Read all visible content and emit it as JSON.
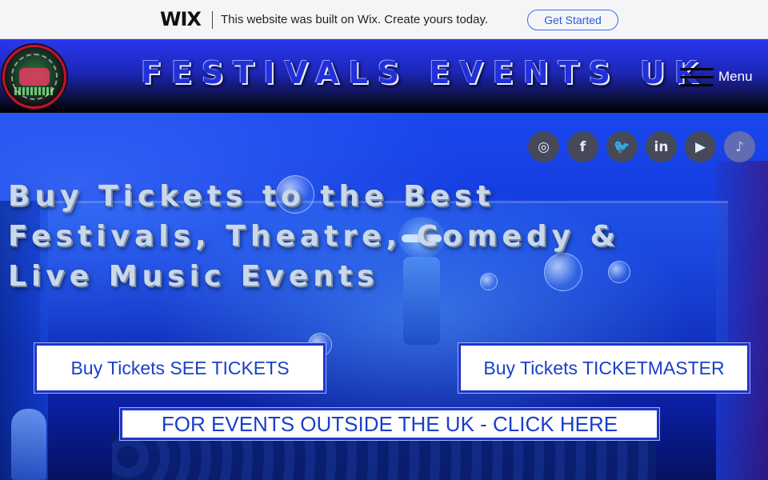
{
  "wix_banner": {
    "logo": "WIX",
    "message": "This website was built on Wix. Create yours today.",
    "cta_label": "Get Started"
  },
  "header": {
    "logo_text": "festivalsevents.uk",
    "title": "FESTIVALS EVENTS UK",
    "menu_label": "Menu",
    "menu_icon": "hamburger-icon"
  },
  "social": {
    "icons": [
      {
        "name": "instagram-icon",
        "glyph": "◎"
      },
      {
        "name": "facebook-icon",
        "glyph": "f"
      },
      {
        "name": "twitter-icon",
        "glyph": "🐦"
      },
      {
        "name": "linkedin-icon",
        "glyph": "in"
      },
      {
        "name": "youtube-icon",
        "glyph": "▶"
      },
      {
        "name": "tiktok-icon",
        "glyph": "♪"
      }
    ]
  },
  "hero": {
    "title_line1": "Buy Tickets to the Best",
    "title_line2": "Festivals, Theatre, Comedy &",
    "title_line3": "Live Music Events",
    "button_see_tickets": "Buy Tickets SEE TICKETS",
    "button_ticketmaster": "Buy Tickets TICKETMASTER",
    "button_outside_uk": "FOR EVENTS OUTSIDE THE UK - CLICK HERE"
  },
  "colors": {
    "header_blue": "#2a38f0",
    "cta_text": "#1a3fc8",
    "wix_button": "#3b6bf0"
  }
}
